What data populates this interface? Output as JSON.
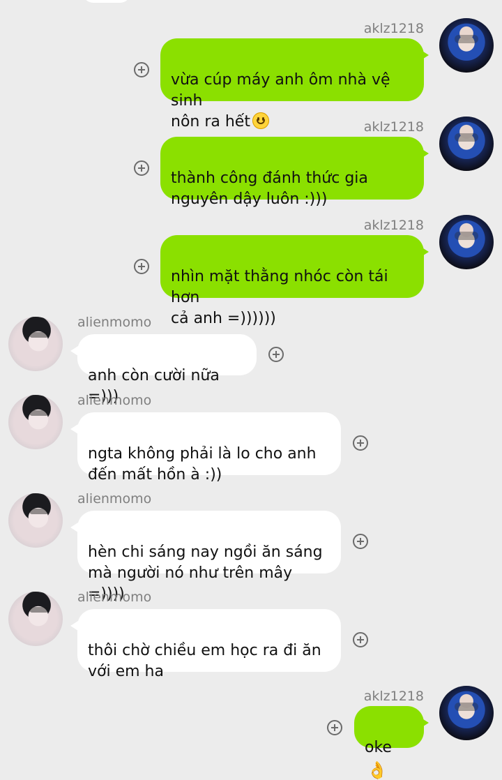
{
  "theme": {
    "background": "#ececec",
    "outgoing_bubble": "#8be000",
    "incoming_bubble": "#ffffff",
    "name_color": "#7f7f7f",
    "text_color": "#111111"
  },
  "messages": [
    {
      "sender": "aklz1218",
      "direction": "out",
      "text": "vừa cúp máy anh ôm nhà vệ sinh\nnôn ra hết",
      "emoji": "smile-icon"
    },
    {
      "sender": "aklz1218",
      "direction": "out",
      "text": "thành công đánh thức gia\nnguyên dậy luôn :)))"
    },
    {
      "sender": "aklz1218",
      "direction": "out",
      "text": "nhìn mặt thằng nhóc còn tái hơn\ncả anh =))))))"
    },
    {
      "sender": "alienmomo",
      "direction": "in",
      "text": "anh còn cười nữa =)))"
    },
    {
      "sender": "alienmomo",
      "direction": "in",
      "text": "ngta không phải là lo cho anh\nđến mất hồn à :))"
    },
    {
      "sender": "alienmomo",
      "direction": "in",
      "text": "hèn chi sáng nay ngồi ăn sáng\nmà người nó như trên mây =))))"
    },
    {
      "sender": "alienmomo",
      "direction": "in",
      "text": "thôi chờ chiều em học ra đi ăn\nvới em ha"
    },
    {
      "sender": "aklz1218",
      "direction": "out",
      "text": "oke",
      "emoji": "ok-hand-icon"
    }
  ]
}
